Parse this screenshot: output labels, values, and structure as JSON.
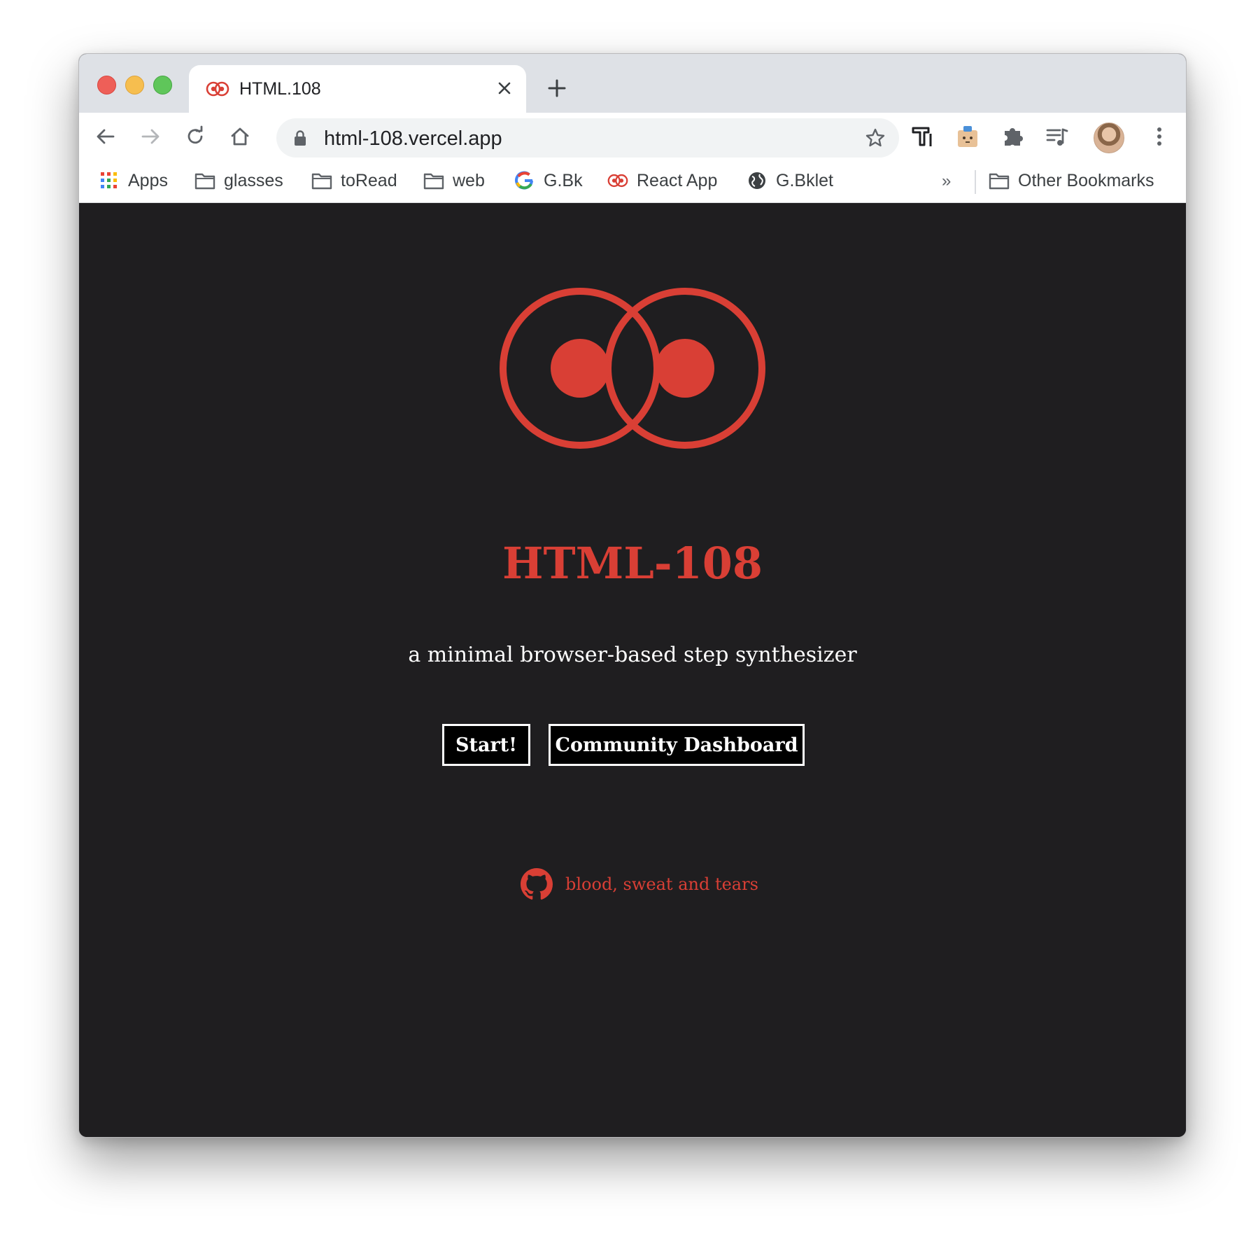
{
  "browser": {
    "tab": {
      "title": "HTML.108"
    },
    "address_bar": {
      "url": "html-108.vercel.app"
    },
    "bookmarks": [
      {
        "label": "Apps",
        "icon": "apps-grid-icon"
      },
      {
        "label": "glasses",
        "icon": "folder-icon"
      },
      {
        "label": "toRead",
        "icon": "folder-icon"
      },
      {
        "label": "web",
        "icon": "folder-icon"
      },
      {
        "label": "G.Bk",
        "icon": "google-icon"
      },
      {
        "label": "React App",
        "icon": "html108-logo-icon"
      },
      {
        "label": "G.Bklet",
        "icon": "globe-icon"
      }
    ],
    "overflow_label": "»",
    "other_bookmarks": "Other Bookmarks"
  },
  "page": {
    "title": "HTML-108",
    "subtitle": "a minimal browser-based step synthesizer",
    "buttons": {
      "start": "Start!",
      "dashboard": "Community Dashboard"
    },
    "footer_link": "blood, sweat and tears"
  },
  "colors": {
    "accent": "#d93f35",
    "page_background": "#1f1e20",
    "button_background": "#000000",
    "button_border": "#ffffff"
  }
}
